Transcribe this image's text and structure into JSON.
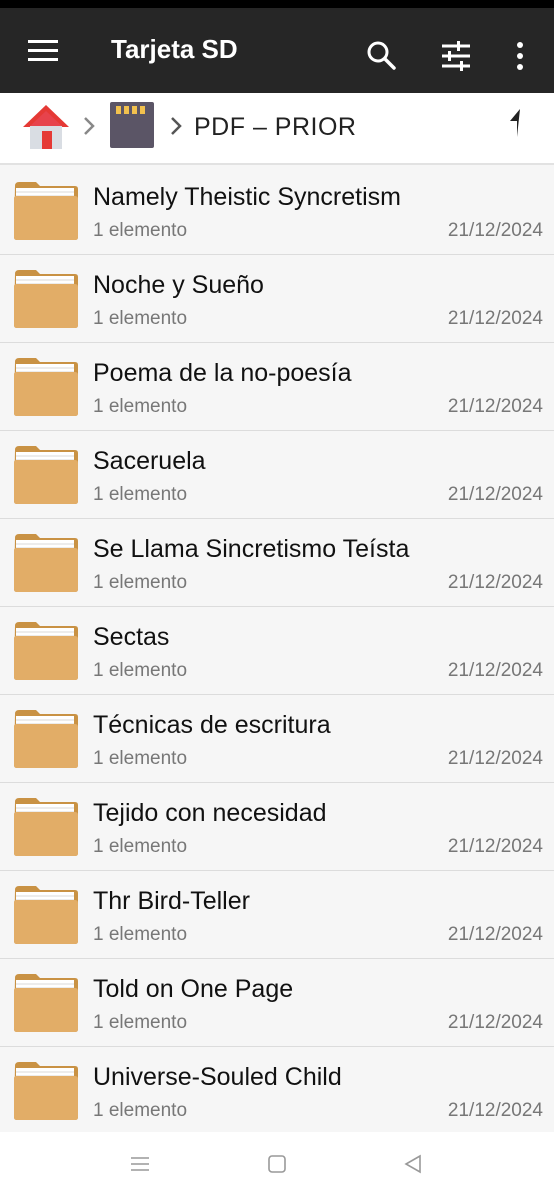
{
  "header": {
    "title": "Tarjeta SD",
    "icons": [
      "menu-icon",
      "search-icon",
      "filter-icon",
      "more-vert-icon"
    ]
  },
  "breadcrumb": {
    "home_icon": "home-icon",
    "storage_icon": "sd-card-icon",
    "current": "PDF – PRIOR",
    "up_icon": "up-arrow-icon"
  },
  "colors": {
    "topbar": "#262626",
    "folder": "#e2ad67",
    "home_roof": "#e53935"
  },
  "items": [
    {
      "name": "Namely Theistic Syncretism",
      "count": "1 elemento",
      "date": "21/12/2024"
    },
    {
      "name": "Noche y Sueño",
      "count": "1 elemento",
      "date": "21/12/2024"
    },
    {
      "name": "Poema de la no-poesía",
      "count": "1 elemento",
      "date": "21/12/2024"
    },
    {
      "name": "Saceruela",
      "count": "1 elemento",
      "date": "21/12/2024"
    },
    {
      "name": "Se Llama Sincretismo Teísta",
      "count": "1 elemento",
      "date": "21/12/2024"
    },
    {
      "name": "Sectas",
      "count": "1 elemento",
      "date": "21/12/2024"
    },
    {
      "name": "Técnicas de escritura",
      "count": "1 elemento",
      "date": "21/12/2024"
    },
    {
      "name": "Tejido con necesidad",
      "count": "1 elemento",
      "date": "21/12/2024"
    },
    {
      "name": "Thr Bird-Teller",
      "count": "1 elemento",
      "date": "21/12/2024"
    },
    {
      "name": "Told on One Page",
      "count": "1 elemento",
      "date": "21/12/2024"
    },
    {
      "name": "Universe-Souled Child",
      "count": "1 elemento",
      "date": "21/12/2024"
    }
  ],
  "navbar": {
    "icons": [
      "recents-icon",
      "home-nav-icon",
      "back-icon"
    ]
  }
}
